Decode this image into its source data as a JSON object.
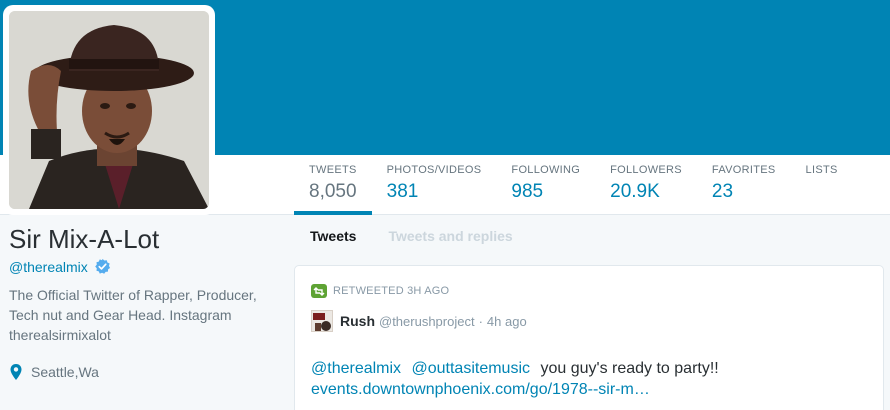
{
  "colors": {
    "banner": "#0084b4",
    "link": "#0084b4",
    "muted": "#66757f",
    "retweet_green": "#5ea334"
  },
  "profile": {
    "name": "Sir Mix-A-Lot",
    "handle": "@therealmix",
    "verified_icon": "verified-badge-icon",
    "bio": "The Official Twitter of Rapper, Producer, Tech nut and Gear Head. Instagram therealsirmixalot",
    "location": "Seattle,Wa",
    "location_icon": "map-pin-icon"
  },
  "stats": [
    {
      "label": "TWEETS",
      "value": "8,050",
      "active": true
    },
    {
      "label": "PHOTOS/VIDEOS",
      "value": "381"
    },
    {
      "label": "FOLLOWING",
      "value": "985"
    },
    {
      "label": "FOLLOWERS",
      "value": "20.9K"
    },
    {
      "label": "FAVORITES",
      "value": "23"
    },
    {
      "label": "LISTS",
      "value": ""
    }
  ],
  "tabs": [
    {
      "label": "Tweets",
      "active": true
    },
    {
      "label": "Tweets and replies",
      "active": false
    }
  ],
  "tweet": {
    "retweet_label": "RETWEETED 3H AGO",
    "retweet_icon": "retweet-icon",
    "author_name": "Rush",
    "author_handle": "@therushproject",
    "separator": "·",
    "time": "4h ago",
    "mention1": "@therealmix",
    "mention2": "@outtasitemusic",
    "body": "you guy's ready to party!!",
    "link": "events.downtownphoenix.com/go/1978--sir-m…"
  }
}
